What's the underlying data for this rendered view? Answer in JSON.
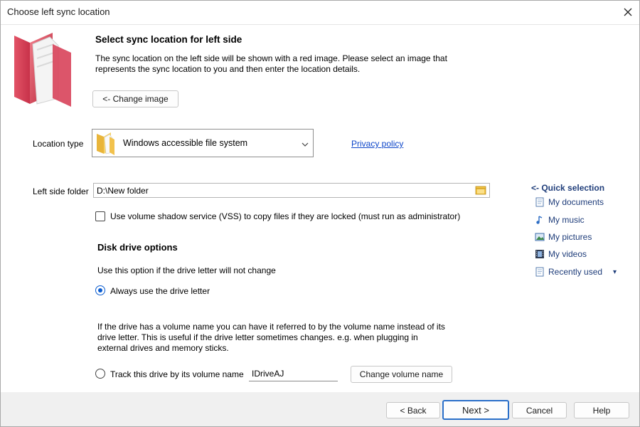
{
  "window": {
    "title": "Choose left sync location",
    "close_glyph": "✕"
  },
  "header": {
    "heading": "Select sync location for left side",
    "description_line1": "The sync location on the left side will be shown with a red image.  Please select an image that",
    "description_line2": "represents the sync location to you and then enter the location details.",
    "change_image_label": "<- Change image",
    "image_icon": "red-folder-icon"
  },
  "location": {
    "label": "Location type",
    "selected": "Windows accessible file system",
    "privacy_link": "Privacy policy"
  },
  "folder": {
    "label": "Left side folder",
    "value": "D:\\New folder",
    "vss_label": "Use volume shadow service (VSS) to copy files if they are locked (must run as administrator)",
    "vss_checked": false
  },
  "quick_selection": {
    "title": "<- Quick selection",
    "items": [
      {
        "label": "My documents",
        "icon": "document-icon"
      },
      {
        "label": "My music",
        "icon": "music-note-icon"
      },
      {
        "label": "My pictures",
        "icon": "picture-icon"
      },
      {
        "label": "My videos",
        "icon": "film-icon"
      },
      {
        "label": "Recently used",
        "icon": "recent-document-icon"
      }
    ],
    "recent_dropdown_glyph": "▾"
  },
  "disk_options": {
    "heading": "Disk drive options",
    "hint": "Use this option if the drive letter will not change",
    "always_label": "Always use the drive letter",
    "always_selected": true,
    "para_line1": "If the drive has a volume name you can have it referred to by the volume name instead of its",
    "para_line2": "drive letter.  This is useful if the drive letter sometimes changes.  e.g. when plugging in",
    "para_line3": "external drives and memory sticks.",
    "track_label": "Track this drive by its volume name",
    "track_selected": false,
    "volume_name": "IDriveAJ",
    "change_volume_label": "Change volume name"
  },
  "footer": {
    "back_label": "< Back",
    "next_label": "Next >",
    "cancel_label": "Cancel",
    "help_label": "Help"
  },
  "colors": {
    "accent": "#2a6fc9",
    "link": "#0c45c9",
    "folder_red": "#d94c5c",
    "folder_yellow": "#f2c24d"
  }
}
